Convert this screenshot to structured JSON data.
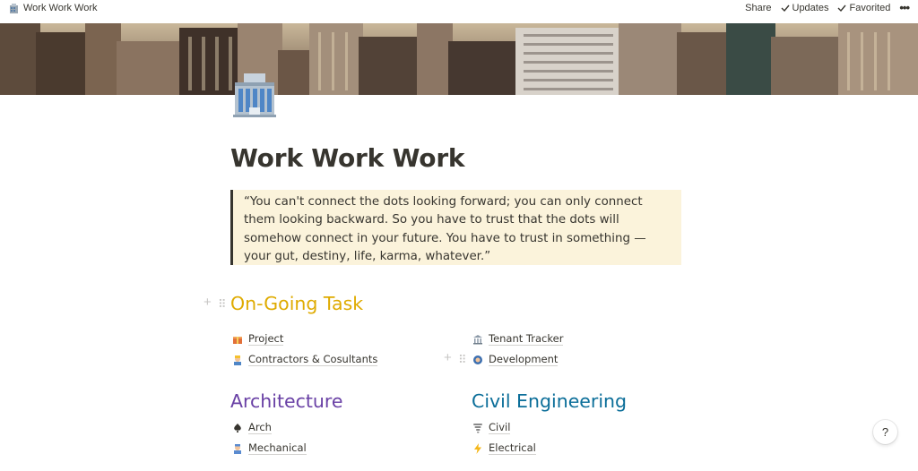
{
  "breadcrumb": {
    "title": "Work Work Work",
    "icon": "office-building-icon"
  },
  "topbar": {
    "share_label": "Share",
    "updates_label": "Updates",
    "favorited_label": "Favorited",
    "more_label": "•••"
  },
  "page": {
    "title": "Work Work Work",
    "icon": "office-building-icon",
    "quote": "“You can't connect the dots looking forward; you can only connect them looking backward. So you have to trust that the dots will somehow connect in your future. You have to trust in something — your gut, destiny, life, karma, whatever.”"
  },
  "sections": {
    "ongoing": {
      "heading": "On-Going Task",
      "color": "#dfab01",
      "left": [
        {
          "label": "Project",
          "icon": "gift-icon"
        },
        {
          "label": "Contractors & Cosultants",
          "icon": "construction-worker-icon"
        }
      ],
      "right": [
        {
          "label": "Tenant Tracker",
          "icon": "bank-icon"
        },
        {
          "label": "Development",
          "icon": "developer-icon"
        }
      ]
    },
    "architecture": {
      "heading": "Architecture",
      "color": "#6940a5",
      "items": [
        {
          "label": "Arch",
          "icon": "spade-icon"
        },
        {
          "label": "Mechanical",
          "icon": "mechanic-icon"
        }
      ]
    },
    "civil": {
      "heading": "Civil Engineering",
      "color": "#0b6e99",
      "items": [
        {
          "label": "Civil",
          "icon": "tornado-icon"
        },
        {
          "label": "Electrical",
          "icon": "lightning-icon"
        }
      ]
    }
  },
  "help": {
    "label": "?"
  }
}
